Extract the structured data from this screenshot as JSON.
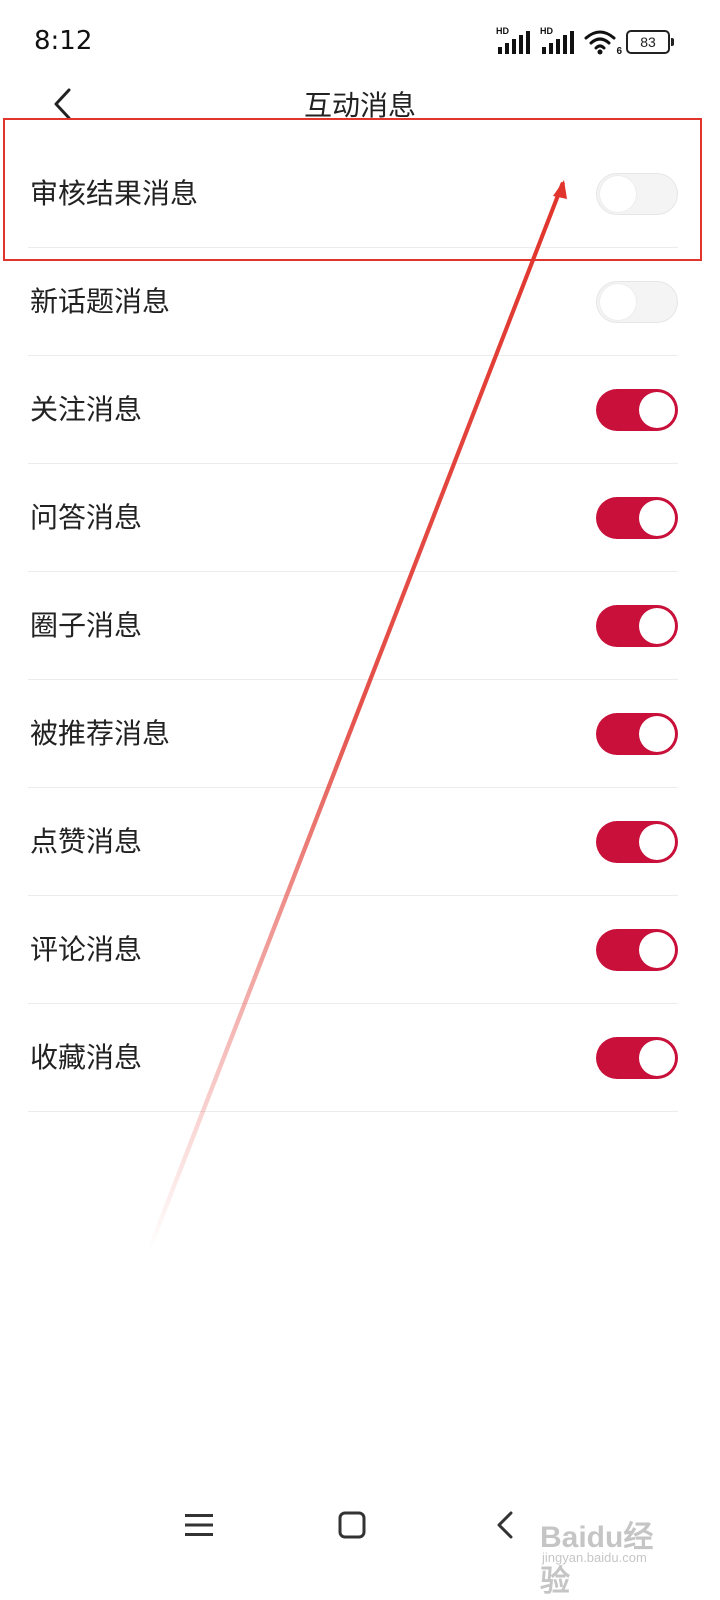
{
  "status_bar": {
    "time": "8:12",
    "signal_1_label": "HD",
    "signal_2_label": "HD",
    "wifi_badge": "6",
    "battery_level": "83"
  },
  "header": {
    "title": "互动消息",
    "back_icon": "chevron-left-icon"
  },
  "settings": [
    {
      "label": "审核结果消息",
      "enabled": false
    },
    {
      "label": "新话题消息",
      "enabled": false
    },
    {
      "label": "关注消息",
      "enabled": true
    },
    {
      "label": "问答消息",
      "enabled": true
    },
    {
      "label": "圈子消息",
      "enabled": true
    },
    {
      "label": "被推荐消息",
      "enabled": true
    },
    {
      "label": "点赞消息",
      "enabled": true
    },
    {
      "label": "评论消息",
      "enabled": true
    },
    {
      "label": "收藏消息",
      "enabled": true
    }
  ],
  "nav_bar": {
    "menu_icon": "menu-icon",
    "home_icon": "home-square-icon",
    "back_icon": "back-chevron-icon"
  },
  "watermark": {
    "text": "Baidu经验",
    "sub": "jingyan.baidu.com"
  },
  "colors": {
    "toggle_on": "#c8103a",
    "toggle_off": "#f4f4f4",
    "annotation": "#e0342c"
  }
}
